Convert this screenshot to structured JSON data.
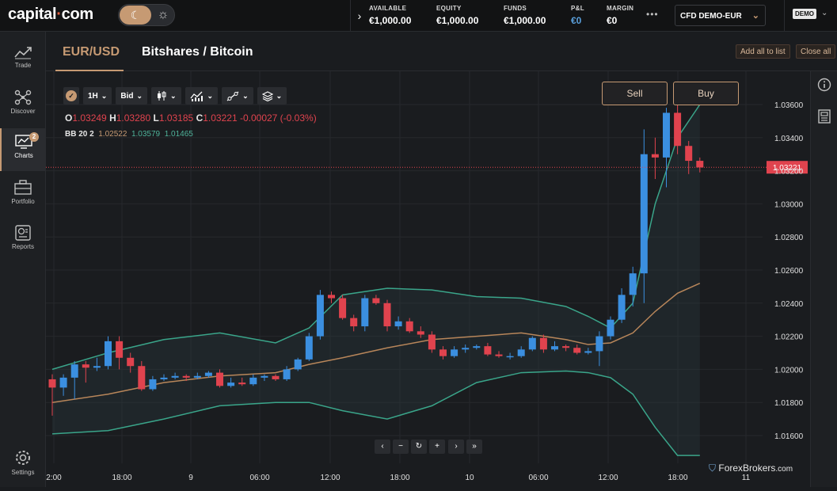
{
  "header": {
    "logo_name": "capital",
    "logo_dot": "·",
    "logo_tld": "com",
    "moon_icon": "☾",
    "sun_icon": "☼",
    "expand_icon": "›",
    "stats": [
      {
        "label": "AVAILABLE",
        "value": "€1,000.00"
      },
      {
        "label": "EQUITY",
        "value": "€1,000.00"
      },
      {
        "label": "FUNDS",
        "value": "€1,000.00"
      },
      {
        "label": "P&L",
        "value": "€0"
      },
      {
        "label": "MARGIN",
        "value": "€0"
      }
    ],
    "more": "•••",
    "account_select": "CFD DEMO-EUR",
    "demo_badge": "DEMO",
    "pnl_color": "#5a9fdb"
  },
  "nav": {
    "items": [
      {
        "label": "Trade",
        "icon": "trend-line-icon"
      },
      {
        "label": "Discover",
        "icon": "network-icon"
      },
      {
        "label": "Charts",
        "icon": "chart-monitor-icon",
        "badge": "2"
      },
      {
        "label": "Portfolio",
        "icon": "briefcase-icon"
      },
      {
        "label": "Reports",
        "icon": "report-icon"
      }
    ],
    "settings_label": "Settings"
  },
  "tabs": [
    {
      "label": "EUR/USD"
    },
    {
      "label": "Bitshares / Bitcoin"
    }
  ],
  "tab_actions": {
    "add_all": "Add all to list",
    "close_all": "Close all"
  },
  "toolbar": {
    "interval": "1H",
    "price_type": "Bid"
  },
  "ohlc": {
    "o_label": "O",
    "o": "1.03249",
    "h_label": "H",
    "h": "1.03280",
    "l_label": "L",
    "l": "1.03185",
    "c_label": "C",
    "c": "1.03221",
    "change": "-0.00027 (-0.03%)"
  },
  "bb": {
    "label": "BB 20 2",
    "mid": "1.02522",
    "upper": "1.03579",
    "lower": "1.01465"
  },
  "trade": {
    "sell": "Sell",
    "buy": "Buy"
  },
  "chart_controls": [
    "‹",
    "−",
    "↻",
    "+",
    "›",
    "»"
  ],
  "watermark": {
    "brand": "ForexBrokers",
    "suffix": ".com"
  },
  "colors": {
    "up": "#3b8fe0",
    "down": "#e0434e",
    "accent": "#c69a73",
    "band": "#3aa58a",
    "mid": "#b8865a"
  },
  "chart_data": {
    "type": "candlestick",
    "y_ticks": [
      "1.03600",
      "1.03400",
      "1.03200",
      "1.03000",
      "1.02800",
      "1.02600",
      "1.02400",
      "1.02200",
      "1.02000",
      "1.01800",
      "1.01600"
    ],
    "x_ticks": [
      "2:00",
      "18:00",
      "9",
      "06:00",
      "12:00",
      "18:00",
      "10",
      "06:00",
      "12:00",
      "18:00",
      "11"
    ],
    "ylim": [
      1.015,
      1.0375
    ],
    "last_price": "1.03221",
    "last_price_value": 1.03221,
    "candles": [
      [
        1.0194,
        1.0189,
        1.0197,
        1.0172
      ],
      [
        1.0189,
        1.0195,
        1.0197,
        1.0184
      ],
      [
        1.0195,
        1.0203,
        1.0205,
        1.0182
      ],
      [
        1.0203,
        1.0201,
        1.0205,
        1.0192
      ],
      [
        1.0201,
        1.0202,
        1.0207,
        1.0199
      ],
      [
        1.0202,
        1.0217,
        1.022,
        1.02
      ],
      [
        1.0217,
        1.0207,
        1.022,
        1.02
      ],
      [
        1.0207,
        1.0202,
        1.021,
        1.0198
      ],
      [
        1.0202,
        1.0188,
        1.0205,
        1.0187
      ],
      [
        1.0188,
        1.0194,
        1.0196,
        1.0187
      ],
      [
        1.0194,
        1.0195,
        1.0197,
        1.0193
      ],
      [
        1.0195,
        1.0196,
        1.0198,
        1.0194
      ],
      [
        1.0196,
        1.0195,
        1.0197,
        1.0193
      ],
      [
        1.0195,
        1.0196,
        1.0198,
        1.0194
      ],
      [
        1.0196,
        1.0198,
        1.0199,
        1.0195
      ],
      [
        1.0198,
        1.019,
        1.02,
        1.0189
      ],
      [
        1.019,
        1.0192,
        1.0195,
        1.0189
      ],
      [
        1.0192,
        1.0191,
        1.0195,
        1.019
      ],
      [
        1.0191,
        1.0195,
        1.0197,
        1.019
      ],
      [
        1.0195,
        1.0196,
        1.0197,
        1.0193
      ],
      [
        1.0196,
        1.0194,
        1.0197,
        1.0193
      ],
      [
        1.0194,
        1.02,
        1.0202,
        1.0193
      ],
      [
        1.02,
        1.0206,
        1.0207,
        1.0199
      ],
      [
        1.0206,
        1.022,
        1.0222,
        1.0205
      ],
      [
        1.022,
        1.0245,
        1.0248,
        1.0218
      ],
      [
        1.0245,
        1.0243,
        1.0247,
        1.024
      ],
      [
        1.0243,
        1.0231,
        1.0245,
        1.023
      ],
      [
        1.0231,
        1.0226,
        1.0233,
        1.0223
      ],
      [
        1.0226,
        1.0243,
        1.0245,
        1.0223
      ],
      [
        1.0243,
        1.024,
        1.0245,
        1.0239
      ],
      [
        1.024,
        1.0226,
        1.0242,
        1.0223
      ],
      [
        1.0226,
        1.0229,
        1.0232,
        1.0224
      ],
      [
        1.0229,
        1.0223,
        1.0231,
        1.0222
      ],
      [
        1.0223,
        1.0221,
        1.0226,
        1.0219
      ],
      [
        1.0221,
        1.0212,
        1.0223,
        1.021
      ],
      [
        1.0212,
        1.0208,
        1.0214,
        1.0206
      ],
      [
        1.0208,
        1.0212,
        1.0214,
        1.0207
      ],
      [
        1.0212,
        1.0213,
        1.0215,
        1.021
      ],
      [
        1.0213,
        1.0214,
        1.0215,
        1.0212
      ],
      [
        1.0214,
        1.0209,
        1.0216,
        1.0208
      ],
      [
        1.0209,
        1.0208,
        1.0211,
        1.0207
      ],
      [
        1.0208,
        1.0208,
        1.021,
        1.0206
      ],
      [
        1.0208,
        1.0212,
        1.0214,
        1.0207
      ],
      [
        1.0212,
        1.0219,
        1.022,
        1.0211
      ],
      [
        1.0219,
        1.0212,
        1.0221,
        1.021
      ],
      [
        1.0212,
        1.0214,
        1.0217,
        1.0211
      ],
      [
        1.0214,
        1.0213,
        1.0215,
        1.0211
      ],
      [
        1.0213,
        1.021,
        1.0215,
        1.0209
      ],
      [
        1.021,
        1.0211,
        1.0213,
        1.0209
      ],
      [
        1.0211,
        1.022,
        1.0223,
        1.0202
      ],
      [
        1.022,
        1.023,
        1.0232,
        1.0218
      ],
      [
        1.023,
        1.0245,
        1.0249,
        1.0228
      ],
      [
        1.0245,
        1.0258,
        1.0262,
        1.0238
      ],
      [
        1.0258,
        1.033,
        1.0345,
        1.024
      ],
      [
        1.033,
        1.0328,
        1.034,
        1.0315
      ],
      [
        1.0328,
        1.0355,
        1.0358,
        1.031
      ],
      [
        1.0355,
        1.0335,
        1.0368,
        1.033
      ],
      [
        1.0335,
        1.0326,
        1.0338,
        1.0318
      ],
      [
        1.0326,
        1.0322,
        1.0328,
        1.0319
      ]
    ],
    "bb_upper": [
      [
        0,
        1.02
      ],
      [
        5,
        1.021
      ],
      [
        10,
        1.0218
      ],
      [
        15,
        1.0222
      ],
      [
        20,
        1.0216
      ],
      [
        23,
        1.0225
      ],
      [
        26,
        1.0245
      ],
      [
        30,
        1.0249
      ],
      [
        34,
        1.0248
      ],
      [
        38,
        1.0244
      ],
      [
        42,
        1.0243
      ],
      [
        46,
        1.0238
      ],
      [
        48,
        1.0232
      ],
      [
        50,
        1.0225
      ],
      [
        52,
        1.024
      ],
      [
        54,
        1.03
      ],
      [
        56,
        1.034
      ],
      [
        58,
        1.036
      ]
    ],
    "bb_mid": [
      [
        0,
        1.018
      ],
      [
        5,
        1.0185
      ],
      [
        10,
        1.0192
      ],
      [
        15,
        1.0196
      ],
      [
        20,
        1.0198
      ],
      [
        23,
        1.0203
      ],
      [
        26,
        1.0207
      ],
      [
        30,
        1.0213
      ],
      [
        34,
        1.0218
      ],
      [
        38,
        1.022
      ],
      [
        42,
        1.0222
      ],
      [
        46,
        1.0218
      ],
      [
        48,
        1.0215
      ],
      [
        50,
        1.0216
      ],
      [
        52,
        1.0222
      ],
      [
        54,
        1.0235
      ],
      [
        56,
        1.0246
      ],
      [
        58,
        1.0252
      ]
    ],
    "bb_lower": [
      [
        0,
        1.0161
      ],
      [
        5,
        1.0163
      ],
      [
        10,
        1.017
      ],
      [
        15,
        1.0178
      ],
      [
        20,
        1.018
      ],
      [
        23,
        1.018
      ],
      [
        26,
        1.0175
      ],
      [
        30,
        1.017
      ],
      [
        34,
        1.0178
      ],
      [
        38,
        1.0192
      ],
      [
        42,
        1.0198
      ],
      [
        46,
        1.0199
      ],
      [
        48,
        1.0198
      ],
      [
        50,
        1.0195
      ],
      [
        52,
        1.0185
      ],
      [
        54,
        1.0165
      ],
      [
        56,
        1.0148
      ],
      [
        58,
        1.0148
      ]
    ]
  }
}
